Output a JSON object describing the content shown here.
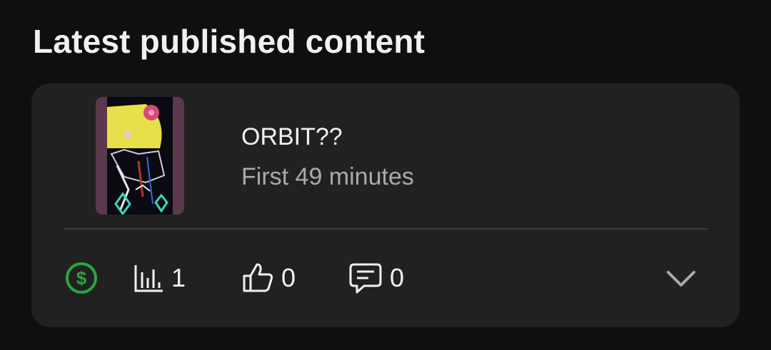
{
  "section": {
    "title": "Latest published content"
  },
  "video": {
    "title": "ORBIT??",
    "subtitle": "First 49 minutes"
  },
  "stats": {
    "monetization_icon": "dollar-circle-icon",
    "monetization_color": "#2ba640",
    "views": "1",
    "likes": "0",
    "comments": "0"
  },
  "icons": {
    "views": "bar-chart-icon",
    "likes": "thumbs-up-icon",
    "comments": "comment-icon",
    "expand": "chevron-down-icon"
  }
}
